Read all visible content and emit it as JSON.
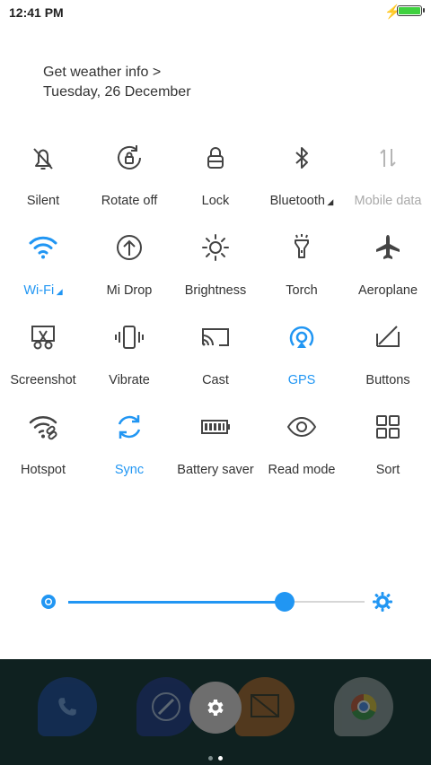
{
  "status_bar": {
    "time": "12:41 PM"
  },
  "header": {
    "weather_link": "Get weather info >",
    "date": "Tuesday, 26 December"
  },
  "toggles": [
    {
      "label": "Silent",
      "icon": "bell-off-icon",
      "state": "off"
    },
    {
      "label": "Rotate off",
      "icon": "rotate-lock-icon",
      "state": "off"
    },
    {
      "label": "Lock",
      "icon": "lock-icon",
      "state": "off"
    },
    {
      "label": "Bluetooth",
      "icon": "bluetooth-icon",
      "state": "off",
      "expandable": true
    },
    {
      "label": "Mobile data",
      "icon": "mobile-data-icon",
      "state": "disabled"
    },
    {
      "label": "Wi-Fi",
      "icon": "wifi-icon",
      "state": "on",
      "expandable": true
    },
    {
      "label": "Mi Drop",
      "icon": "upload-circle-icon",
      "state": "off"
    },
    {
      "label": "Brightness",
      "icon": "sun-icon",
      "state": "off"
    },
    {
      "label": "Torch",
      "icon": "torch-icon",
      "state": "off"
    },
    {
      "label": "Aeroplane",
      "icon": "airplane-icon",
      "state": "off"
    },
    {
      "label": "Screenshot",
      "icon": "scissors-icon",
      "state": "off"
    },
    {
      "label": "Vibrate",
      "icon": "vibrate-icon",
      "state": "off"
    },
    {
      "label": "Cast",
      "icon": "cast-icon",
      "state": "off"
    },
    {
      "label": "GPS",
      "icon": "location-icon",
      "state": "on"
    },
    {
      "label": "Buttons",
      "icon": "buttons-icon",
      "state": "off"
    },
    {
      "label": "Hotspot",
      "icon": "hotspot-icon",
      "state": "off"
    },
    {
      "label": "Sync",
      "icon": "sync-icon",
      "state": "on"
    },
    {
      "label": "Battery saver",
      "icon": "battery-icon",
      "state": "off"
    },
    {
      "label": "Read mode",
      "icon": "eye-icon",
      "state": "off"
    },
    {
      "label": "Sort",
      "icon": "grid-icon",
      "state": "off"
    }
  ],
  "brightness": {
    "level": 0.73
  },
  "colors": {
    "accent": "#2196f3",
    "text": "#333333",
    "disabled": "#aaaaaa",
    "dock_bg": "#0f2120"
  },
  "dock": {
    "apps": [
      {
        "name": "phone-app",
        "color": "#1a3a8a"
      },
      {
        "name": "compass-app",
        "color": "#1e2a7a"
      },
      {
        "name": "gallery-app",
        "color": "#a5561d"
      },
      {
        "name": "chrome-app",
        "color": "#8a8a8a"
      }
    ],
    "page_indicator": {
      "count": 2,
      "current": 1
    }
  }
}
